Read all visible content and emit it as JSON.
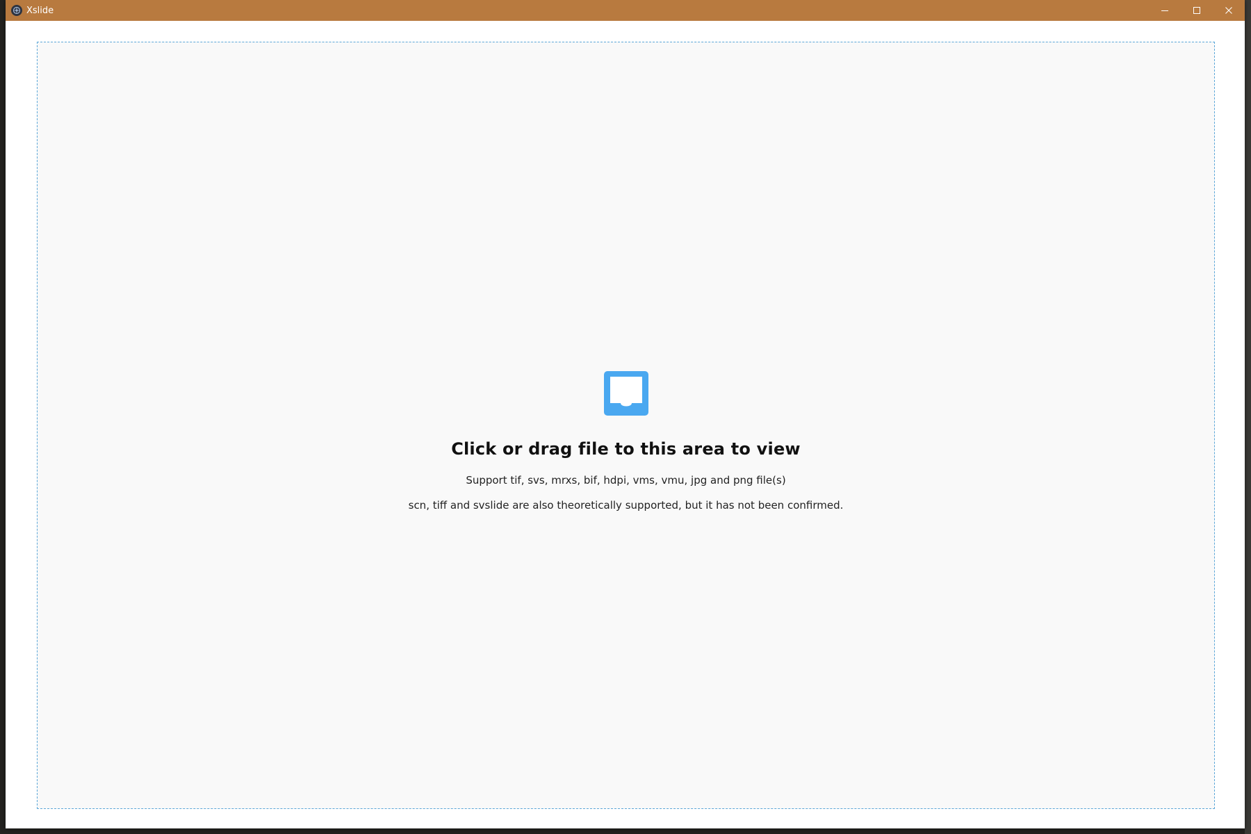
{
  "window": {
    "title": "Xslide",
    "titlebar_color": "#b87a3f",
    "app_icon": "app-logo-icon",
    "controls": {
      "minimize_icon": "minimize-icon",
      "maximize_icon": "maximize-icon",
      "close_icon": "close-icon"
    }
  },
  "dropzone": {
    "icon": "inbox-icon",
    "icon_color": "#4aa8f0",
    "title": "Click or drag file to this area to view",
    "hint_supported": "Support tif, svs, mrxs, bif, hdpi, vms, vmu, jpg and png file(s)",
    "hint_theoretical": "scn, tiff and svslide are also theoretically supported, but it has not been confirmed.",
    "border_color": "#5aa6d8"
  }
}
